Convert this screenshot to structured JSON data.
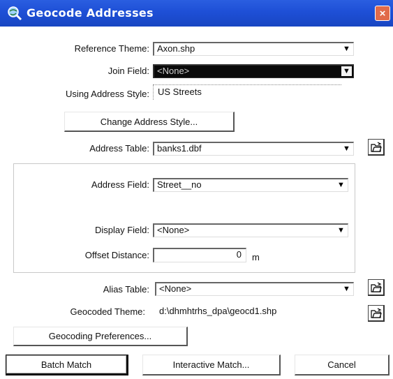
{
  "window": {
    "title": "Geocode Addresses",
    "close_glyph": "×",
    "title_icon": "globe-magnifier-icon"
  },
  "form": {
    "reference_theme": {
      "label": "Reference Theme:",
      "value": "Axon.shp"
    },
    "join_field": {
      "label": "Join Field:",
      "value": "<None>"
    },
    "address_style": {
      "label": "Using Address Style:",
      "value": "US Streets"
    },
    "change_style_button": "Change Address Style...",
    "address_table": {
      "label": "Address Table:",
      "value": "banks1.dbf"
    },
    "address_field": {
      "label": "Address Field:",
      "value": "Street__no"
    },
    "display_field": {
      "label": "Display Field:",
      "value": "<None>"
    },
    "offset_distance": {
      "label": "Offset Distance:",
      "value": "0",
      "unit": "m"
    },
    "alias_table": {
      "label": "Alias Table:",
      "value": "<None>"
    },
    "geocoded_theme": {
      "label": "Geocoded Theme:",
      "value": "d:\\dhmhtrhs_dpa\\geocd1.shp"
    },
    "preferences_button": "Geocoding Preferences..."
  },
  "buttons": {
    "batch": "Batch Match",
    "interactive": "Interactive Match...",
    "cancel": "Cancel"
  },
  "icons": {
    "browse": "open-folder-icon",
    "dropdown": "chevron-down-icon"
  },
  "colors": {
    "titlebar": "#1e4fd6",
    "close": "#e16b4a"
  }
}
